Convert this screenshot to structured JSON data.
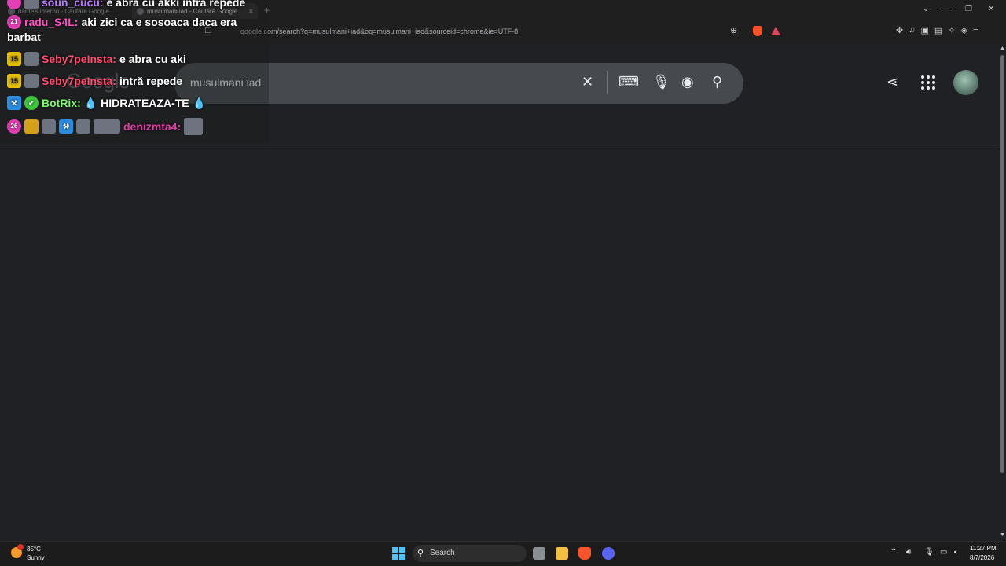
{
  "browser": {
    "tabs": [
      {
        "label": "dante's inferno - Căutare Google"
      },
      {
        "label": "musulmani iad - Căutare Google",
        "close": "×"
      }
    ],
    "new_tab": "+",
    "url": "google.com/search?q=musulmani+iad&oq=musulmani+iad&sourceid=chrome&ie=UTF-8",
    "window_controls": {
      "dropdown": "⌄",
      "minimize": "—",
      "restore": "❐",
      "close": "✕"
    }
  },
  "google": {
    "logo": "Google",
    "query": "musulmani iad",
    "icons": [
      "clear-icon",
      "keyboard-icon",
      "mic-icon",
      "lens-icon",
      "search-icon",
      "share-icon",
      "apps-icon",
      "avatar"
    ]
  },
  "chat": {
    "messages": [
      {
        "user": "soun_cucu:",
        "text": "e abra cu akki intra repede",
        "color": "#b87cff"
      },
      {
        "user": "radu_S4L:",
        "text": "aki zici ca e sosoaca daca era",
        "text2": "barbat",
        "color": "#ff4fc3",
        "badge": "21"
      },
      {
        "user": "Seby7peInsta:",
        "text": "e abra cu aki",
        "color": "#ff4d6d",
        "badge": "15"
      },
      {
        "user": "Seby7peInsta:",
        "text": "intră repede",
        "color": "#ff4d6d",
        "badge": "15"
      },
      {
        "user": "BotRix:",
        "text": "💧 HIDRATEAZA-TE 💧",
        "color": "#7cfc6a"
      },
      {
        "user": "denizmta4:",
        "text": "",
        "color": "#e040a8",
        "badge": "26"
      }
    ]
  },
  "taskbar": {
    "weather": {
      "temp": "35°C",
      "condition": "Sunny"
    },
    "search_label": "Search",
    "time": "11:27 PM",
    "date": "8/7/2026"
  }
}
